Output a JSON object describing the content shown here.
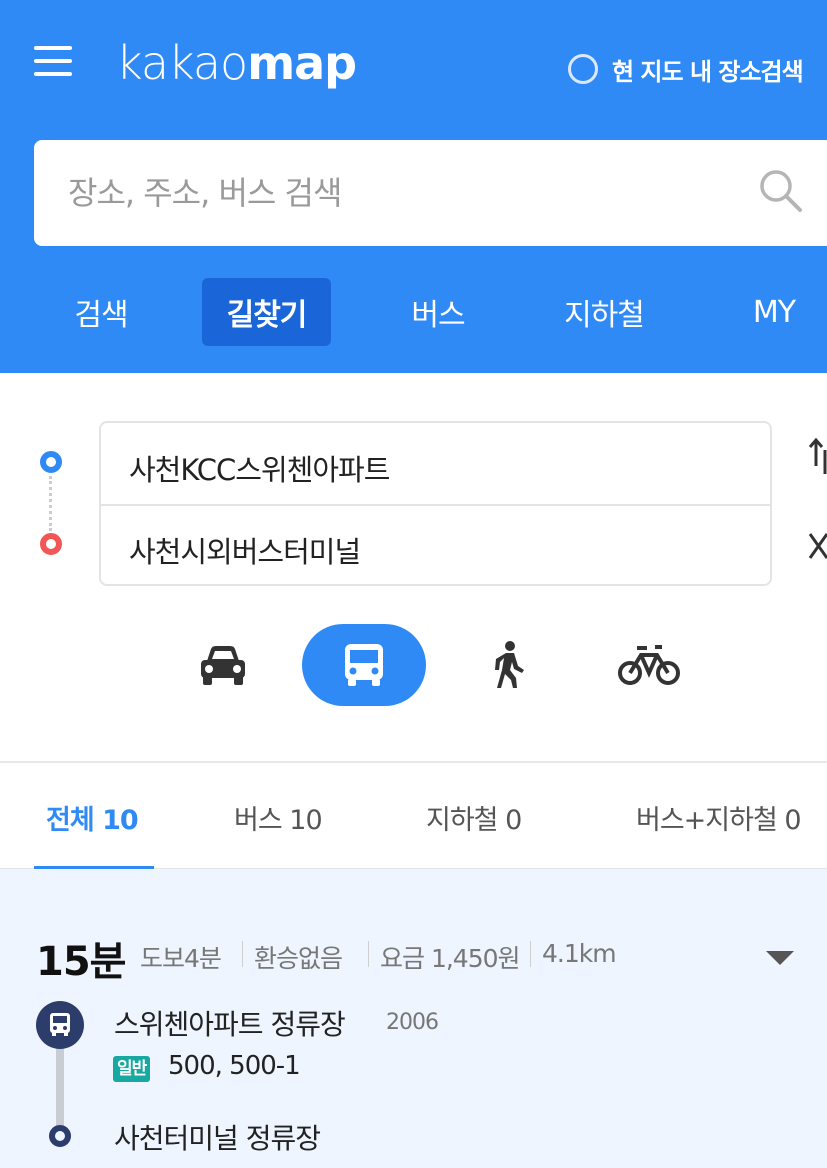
{
  "header": {
    "logo_light": "kakao",
    "logo_bold": "map",
    "map_search_label": "현 지도 내 장소검색",
    "search_placeholder": "장소, 주소, 버스 검색",
    "nav_tabs": [
      {
        "label": "검색",
        "active": false
      },
      {
        "label": "길찾기",
        "active": true
      },
      {
        "label": "버스",
        "active": false
      },
      {
        "label": "지하철",
        "active": false
      },
      {
        "label": "MY",
        "active": false
      }
    ]
  },
  "route": {
    "origin": "사천KCC스위첸아파트",
    "destination": "사천시외버스터미널"
  },
  "transport_modes": [
    {
      "icon": "car-icon",
      "active": false
    },
    {
      "icon": "bus-icon",
      "active": true
    },
    {
      "icon": "walk-icon",
      "active": false
    },
    {
      "icon": "bicycle-icon",
      "active": false
    }
  ],
  "result_tabs": [
    {
      "label": "전체 10",
      "active": true
    },
    {
      "label": "버스 10",
      "active": false
    },
    {
      "label": "지하철 0",
      "active": false
    },
    {
      "label": "버스+지하철 0",
      "active": false
    }
  ],
  "result": {
    "duration": "15분",
    "walk": "도보4분",
    "transfer": "환승없음",
    "fare": "요금 1,450원",
    "distance": "4.1km",
    "board_stop": "스위첸아파트 정류장",
    "board_stop_code": "2006",
    "bus_type": "일반",
    "bus_numbers": "500, 500-1",
    "alight_stop": "사천터미널 정류장"
  },
  "colors": {
    "brand_blue": "#2f8af6",
    "active_tab": "#1a66d9",
    "origin_dot": "#2f8af6",
    "destination_dot": "#f25757",
    "bus_badge": "#17a8a1",
    "result_bg": "#eef5ff"
  }
}
